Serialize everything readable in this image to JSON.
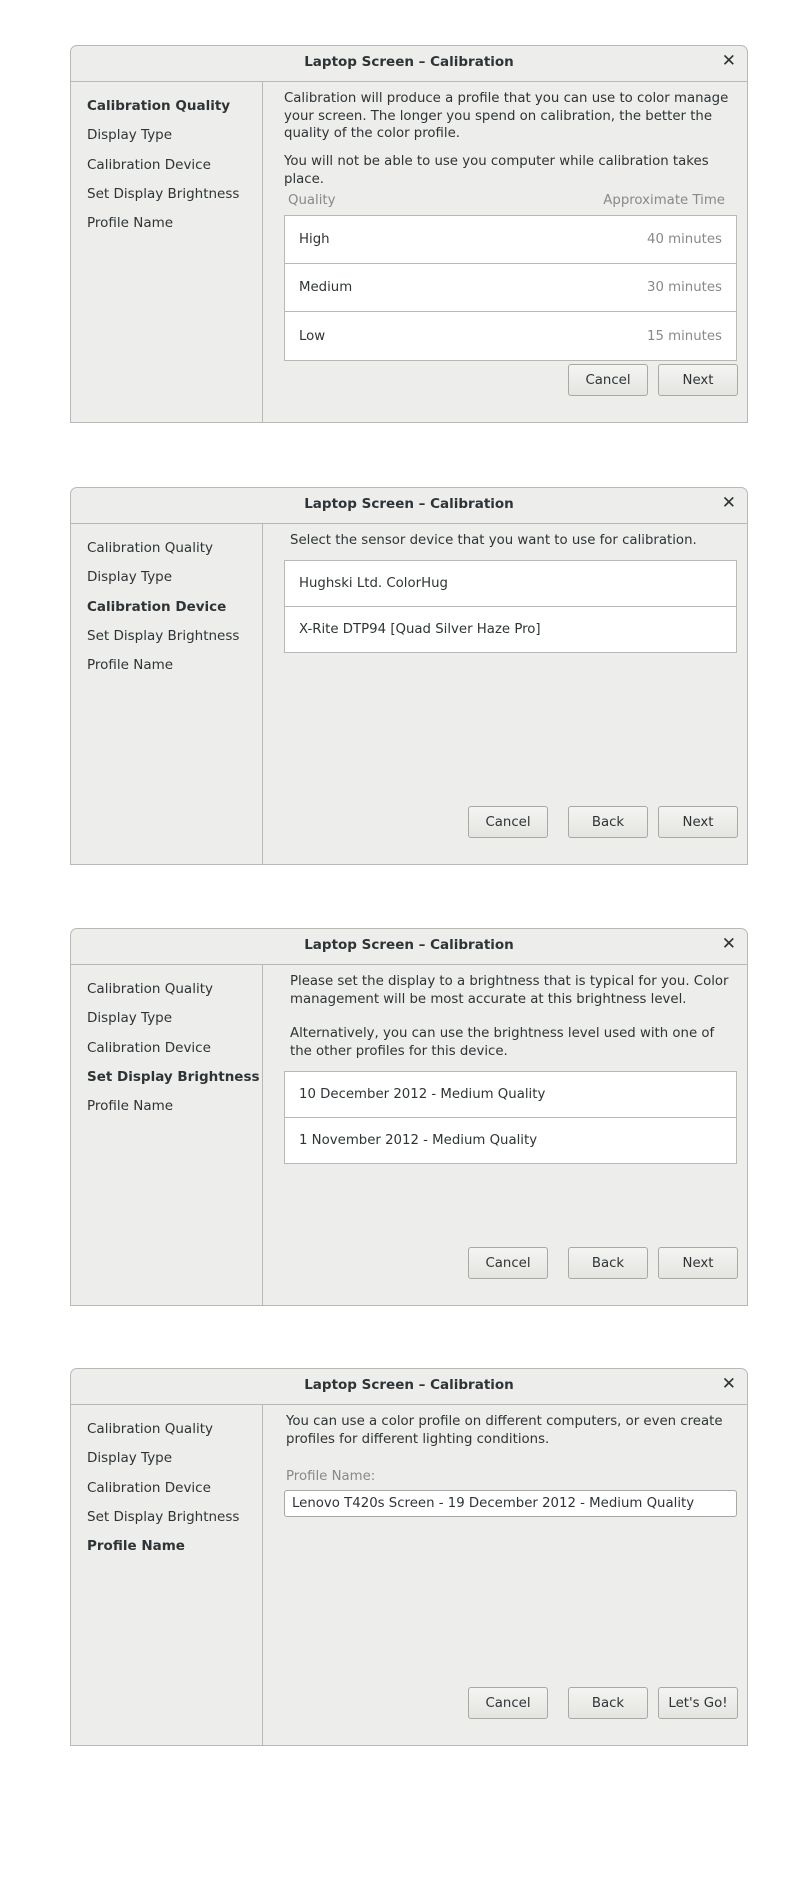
{
  "window_title": "Laptop Screen – Calibration",
  "close_glyph": "✕",
  "steps": [
    "Calibration Quality",
    "Display Type",
    "Calibration Device",
    "Set Display Brightness",
    "Profile Name"
  ],
  "buttons": {
    "cancel": "Cancel",
    "back": "Back",
    "next": "Next",
    "finish": "Let's Go!"
  },
  "quality_page": {
    "active_step": "Calibration Quality",
    "intro": "Calibration will produce a profile that you can use to color manage your screen. The longer you spend on calibration, the better the quality of the color profile.",
    "warning": "You will not be able to use you computer while calibration takes place.",
    "col_quality": "Quality",
    "col_time": "Approximate Time",
    "options": [
      {
        "label": "High",
        "time": "40 minutes"
      },
      {
        "label": "Medium",
        "time": "30 minutes"
      },
      {
        "label": "Low",
        "time": "15 minutes"
      }
    ]
  },
  "device_page": {
    "active_step": "Calibration Device",
    "intro": "Select the sensor device that you want to use for calibration.",
    "devices": [
      "Hughski Ltd. ColorHug",
      "X-Rite DTP94 [Quad Silver Haze Pro]"
    ]
  },
  "brightness_page": {
    "active_step": "Set Display Brightness",
    "intro": "Please set the display to a brightness that is typical for you. Color management will be most accurate at this brightness level.",
    "alt": "Alternatively, you can use the brightness level used with one of the other profiles for this device.",
    "profiles": [
      "10 December 2012 - Medium Quality",
      "1 November 2012 - Medium Quality"
    ]
  },
  "profile_page": {
    "active_step": "Profile Name",
    "intro": "You can use a color profile on different computers, or even create profiles for different lighting conditions.",
    "field_label": "Profile Name:",
    "field_value": "Lenovo T420s Screen - 19 December 2012 - Medium Quality"
  },
  "colors": {
    "dialog_bg": "#ededeb",
    "border": "#b8b8b5",
    "muted_text": "#888a85",
    "text": "#2e3436"
  }
}
